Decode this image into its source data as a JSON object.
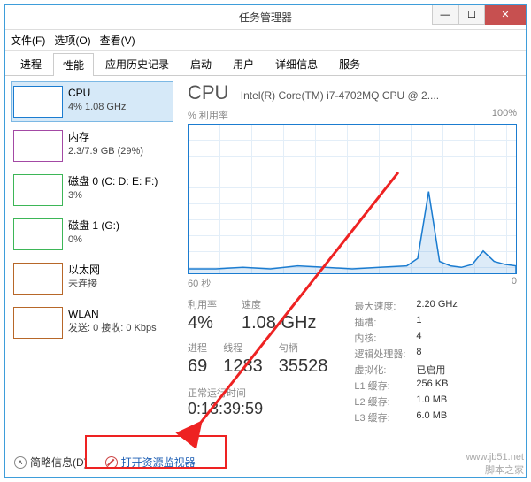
{
  "title": "任务管理器",
  "menus": {
    "file": "文件(F)",
    "options": "选项(O)",
    "view": "查看(V)"
  },
  "tabs": [
    "进程",
    "性能",
    "应用历史记录",
    "启动",
    "用户",
    "详细信息",
    "服务"
  ],
  "activeTab": "性能",
  "sidebar": [
    {
      "name": "CPU",
      "detail": "4% 1.08 GHz"
    },
    {
      "name": "内存",
      "detail": "2.3/7.9 GB (29%)"
    },
    {
      "name": "磁盘 0 (C: D: E: F:)",
      "detail": "3%"
    },
    {
      "name": "磁盘 1 (G:)",
      "detail": "0%"
    },
    {
      "name": "以太网",
      "detail": "未连接"
    },
    {
      "name": "WLAN",
      "detail": "发送: 0 接收: 0 Kbps"
    }
  ],
  "header": {
    "label": "CPU",
    "model": "Intel(R) Core(TM) i7-4702MQ CPU @ 2...."
  },
  "chart": {
    "yLabel": "% 利用率",
    "yMax": "100%",
    "xLeft": "60 秒",
    "xRight": "0"
  },
  "stats": {
    "util_label": "利用率",
    "util": "4%",
    "speed_label": "速度",
    "speed": "1.08 GHz",
    "proc_label": "进程",
    "proc": "69",
    "threads_label": "线程",
    "threads": "1283",
    "handles_label": "句柄",
    "handles": "35528",
    "uptime_label": "正常运行时间",
    "uptime": "0:13:39:59"
  },
  "right_stats": [
    {
      "k": "最大速度:",
      "v": "2.20 GHz"
    },
    {
      "k": "插槽:",
      "v": "1"
    },
    {
      "k": "内核:",
      "v": "4"
    },
    {
      "k": "逻辑处理器:",
      "v": "8"
    },
    {
      "k": "虚拟化:",
      "v": "已启用"
    },
    {
      "k": "L1 缓存:",
      "v": "256 KB"
    },
    {
      "k": "L2 缓存:",
      "v": "1.0 MB"
    },
    {
      "k": "L3 缓存:",
      "v": "6.0 MB"
    }
  ],
  "footer": {
    "less": "简略信息(D)",
    "resmon": "打开资源监视器"
  },
  "watermark": "www.jb51.net\n脚本之家",
  "chart_data": {
    "type": "line",
    "title": "CPU % 利用率",
    "ylabel": "% 利用率",
    "xlabel": "秒",
    "ylim": [
      0,
      100
    ],
    "xlim": [
      60,
      0
    ],
    "x": [
      60,
      55,
      50,
      45,
      40,
      35,
      30,
      25,
      20,
      18,
      16,
      14,
      12,
      10,
      8,
      6,
      4,
      2,
      0
    ],
    "values": [
      3,
      3,
      4,
      3,
      5,
      4,
      3,
      4,
      5,
      10,
      55,
      8,
      5,
      4,
      6,
      15,
      8,
      6,
      5
    ]
  }
}
